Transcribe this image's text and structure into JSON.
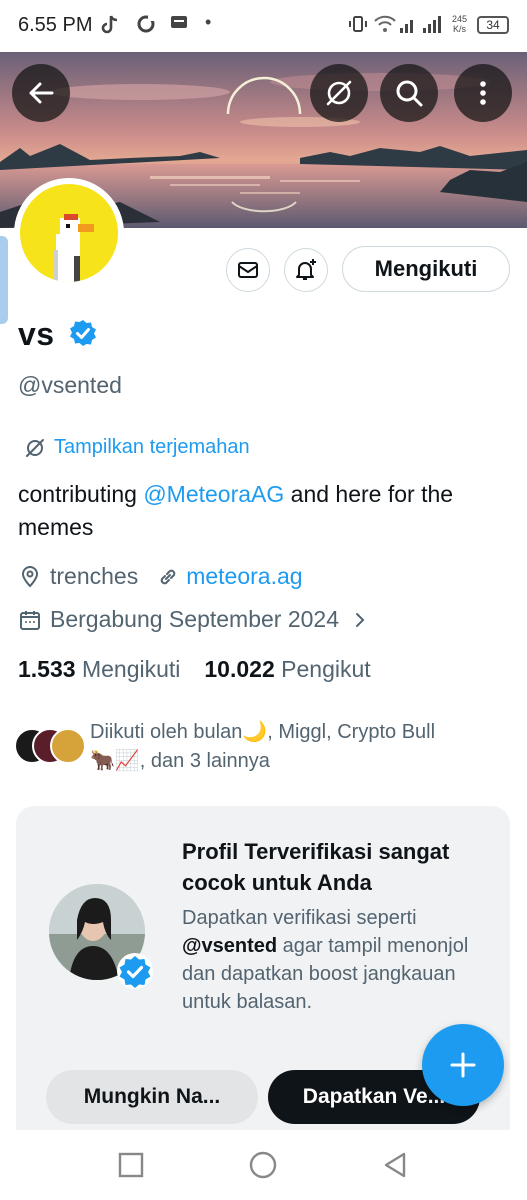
{
  "status_bar": {
    "time": "6.55 PM",
    "net_speed_value": "245",
    "net_speed_unit": "K/s",
    "battery": "34",
    "dot": "•"
  },
  "profile": {
    "name": "vs",
    "handle": "@vsented",
    "translate_label": "Tampilkan terjemahan",
    "bio_prefix": "contributing ",
    "bio_mention": "@MeteoraAG",
    "bio_suffix": " and here for the memes",
    "location": "trenches",
    "website": "meteora.ag",
    "joined": "Bergabung September 2024",
    "following_count": "1.533",
    "following_label": "Mengikuti",
    "followers_count": "10.022",
    "followers_label": "Pengikut",
    "followed_by_line1": "Diikuti oleh bulan🌙, Miggl, Crypto Bull",
    "followed_by_line2": "🐂📈, dan 3 lainnya"
  },
  "actions": {
    "follow_label": "Mengikuti"
  },
  "promo_card": {
    "title": "Profil Terverifikasi sangat cocok untuk Anda",
    "desc_prefix": "Dapatkan verifikasi seperti ",
    "desc_handle": "@vsented",
    "desc_suffix": " agar tampil menonjol dan dapatkan boost jangkauan untuk balasan.",
    "btn_maybe": "Mungkin Na...",
    "btn_verify": "Dapatkan Ve..."
  },
  "colors": {
    "accent": "#1d9bf0",
    "text": "#0f1419",
    "muted": "#536471"
  },
  "icons": [
    "back-arrow-icon",
    "translate-icon",
    "search-icon",
    "more-vertical-icon",
    "mail-icon",
    "bell-plus-icon",
    "verified-badge-icon",
    "location-icon",
    "link-icon",
    "calendar-icon",
    "chevron-right-icon",
    "plus-icon",
    "nav-square-icon",
    "nav-circle-icon",
    "nav-triangle-icon"
  ]
}
